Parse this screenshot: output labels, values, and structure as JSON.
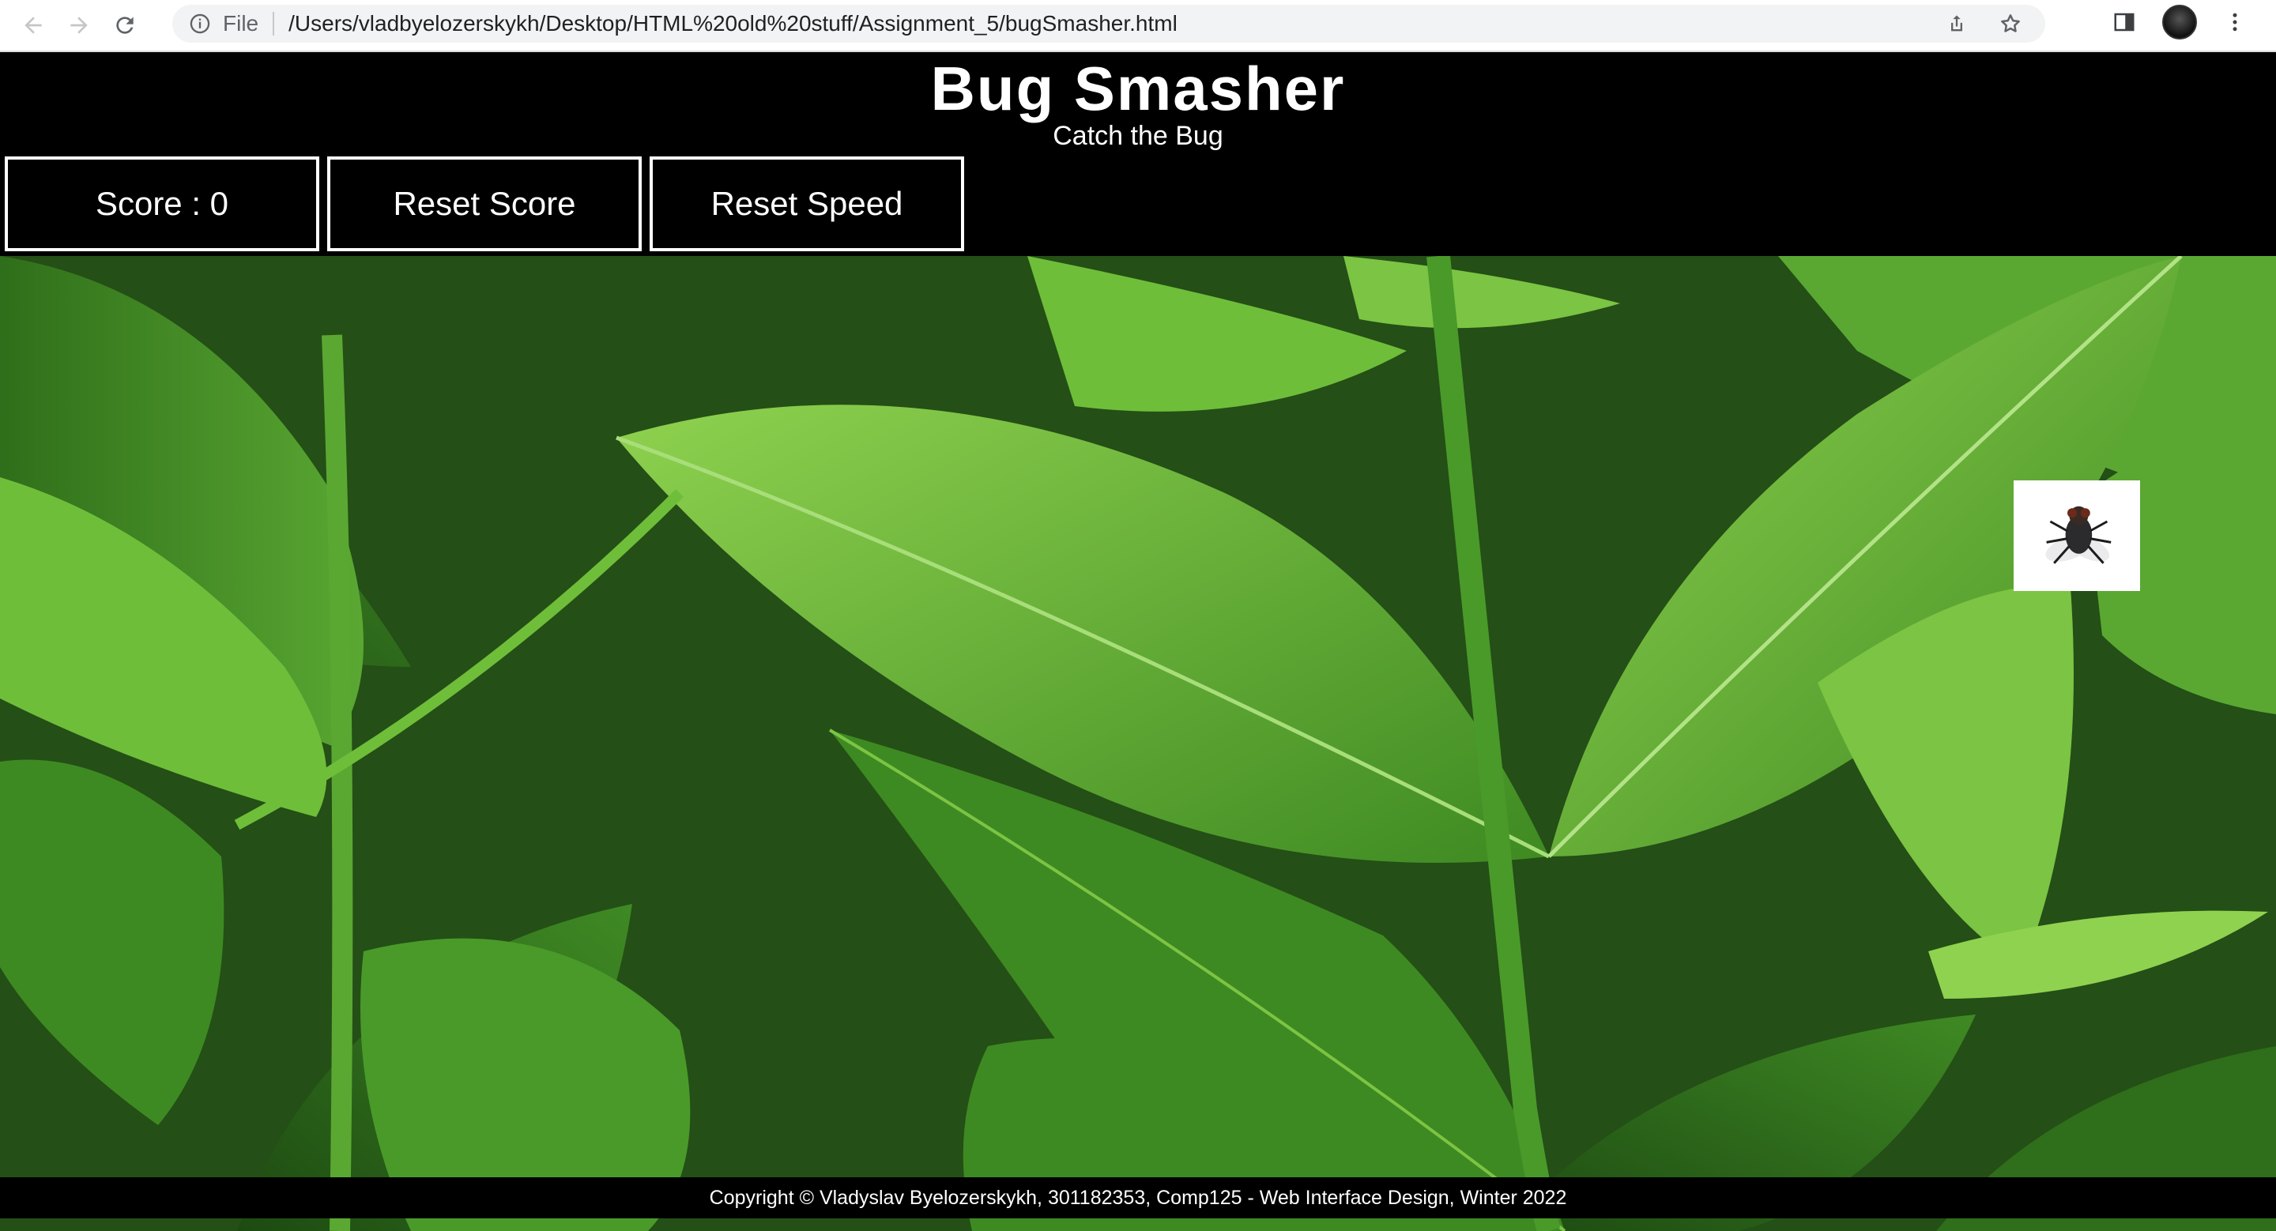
{
  "browser": {
    "url_scheme_label": "File",
    "url": "/Users/vladbyelozerskykh/Desktop/HTML%20old%20stuff/Assignment_5/bugSmasher.html"
  },
  "header": {
    "title": "Bug Smasher",
    "subtitle": "Catch the Bug"
  },
  "controls": {
    "score_label": "Score : 0",
    "reset_score_label": "Reset Score",
    "reset_speed_label": "Reset Speed"
  },
  "game": {
    "background": "green leaves",
    "bug_icon": "fly-icon"
  },
  "footer": {
    "copyright": "Copyright © Vladyslav Byelozerskykh, 301182353, Comp125 - Web Interface Design, Winter 2022"
  },
  "colors": {
    "page_bg": "#000000",
    "text": "#ffffff",
    "button_border": "#ffffff",
    "leaf_dark": "#1f4d14",
    "leaf_mid": "#3f8a24",
    "leaf_light": "#7cc443"
  }
}
